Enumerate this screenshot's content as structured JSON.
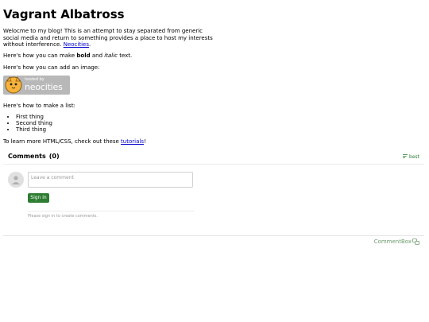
{
  "title": "Vagrant Albatross",
  "intro": {
    "text": "Welocme to my blog! This is an attempt to stay separated from generic social media and return to something provides a place to host my interests without interference.",
    "link": "Neocities",
    "after": "."
  },
  "formatting": {
    "prefix": "Here's how you can make ",
    "bold": "bold",
    "middle": " and ",
    "italic": "italic",
    "suffix": " text."
  },
  "image_line": "Here's how you can add an image:",
  "badge": {
    "small": "hosted by",
    "big": "neocities",
    "icon": "neocities-cat-icon"
  },
  "list_line": "Here's how to make a list:",
  "list_items": [
    "First thing",
    "Second thing",
    "Third thing"
  ],
  "learn": {
    "prefix": "To learn more HTML/CSS, check out these ",
    "link": "tutorials",
    "suffix": "!"
  },
  "comments": {
    "header": "Comments",
    "count": "(0)",
    "sort": "best",
    "sort_icon": "sort-icon",
    "placeholder": "Leave a comment",
    "signin": "Sign in",
    "note": "Please sign in to create comments.",
    "brand": "CommentBox",
    "brand_icon": "commentbox-logo-icon"
  },
  "colors": {
    "accent_green": "#2e7d32",
    "link_blue": "#0000cc"
  }
}
